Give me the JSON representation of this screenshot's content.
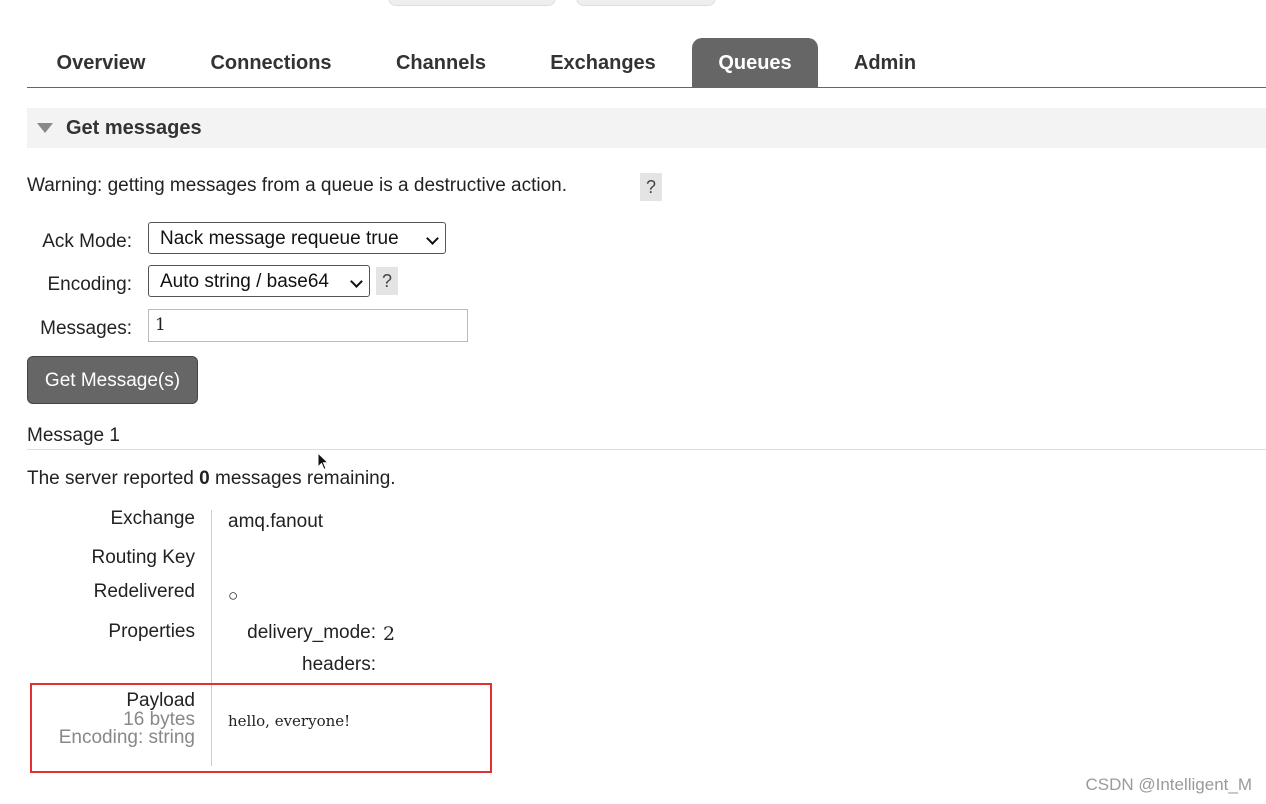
{
  "nav": {
    "tabs": [
      {
        "label": "Overview",
        "active": false
      },
      {
        "label": "Connections",
        "active": false
      },
      {
        "label": "Channels",
        "active": false
      },
      {
        "label": "Exchanges",
        "active": false
      },
      {
        "label": "Queues",
        "active": true
      },
      {
        "label": "Admin",
        "active": false
      }
    ]
  },
  "section": {
    "title": "Get messages",
    "icon": "triangle-down-icon"
  },
  "warning": {
    "text": "Warning: getting messages from a queue is a destructive action.",
    "help": "?"
  },
  "form": {
    "ack_mode_label": "Ack Mode:",
    "ack_mode_value": "Nack message requeue true",
    "encoding_label": "Encoding:",
    "encoding_value": "Auto string / base64",
    "encoding_help": "?",
    "messages_label": "Messages:",
    "messages_value": "1",
    "submit_label": "Get Message(s)"
  },
  "result": {
    "message_title": "Message 1",
    "server_prefix": "The server reported",
    "remaining_count": "0",
    "server_suffix": "messages remaining.",
    "exchange_label": "Exchange",
    "exchange_value": "amq.fanout",
    "routing_key_label": "Routing Key",
    "routing_key_value": "",
    "redelivered_label": "Redelivered",
    "redelivered_value": "○",
    "properties_label": "Properties",
    "properties": [
      {
        "key": "delivery_mode:",
        "value": "2"
      },
      {
        "key": "headers:",
        "value": ""
      }
    ],
    "payload_label": "Payload",
    "payload_size": "16 bytes",
    "payload_encoding": "Encoding: string",
    "payload_value": "hello, everyone!"
  },
  "watermark": "CSDN @Intelligent_M",
  "colors": {
    "tab_active_bg": "#666666",
    "button_bg": "#666666",
    "highlight_border": "#e03030"
  }
}
